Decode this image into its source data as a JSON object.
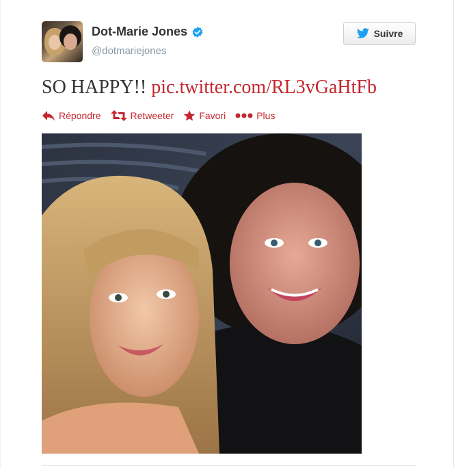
{
  "tweet": {
    "display_name": "Dot-Marie Jones",
    "handle": "@dotmariejones",
    "verified": true,
    "follow_label": "Suivre",
    "text_plain": "SO HAPPY!!",
    "text_link": "pic.twitter.com/RL3vGaHtFb"
  },
  "actions": {
    "reply": "Répondre",
    "retweet": "Retweeter",
    "favorite": "Favori",
    "more": "Plus"
  },
  "colors": {
    "link": "#c3282f",
    "verified": "#1da1f2",
    "twitter_bird": "#1da1f2"
  },
  "icons": {
    "reply": "reply-icon",
    "retweet": "retweet-icon",
    "favorite": "star-icon",
    "more": "more-dots-icon",
    "follow": "twitter-bird-icon",
    "verified": "verified-badge-icon"
  }
}
